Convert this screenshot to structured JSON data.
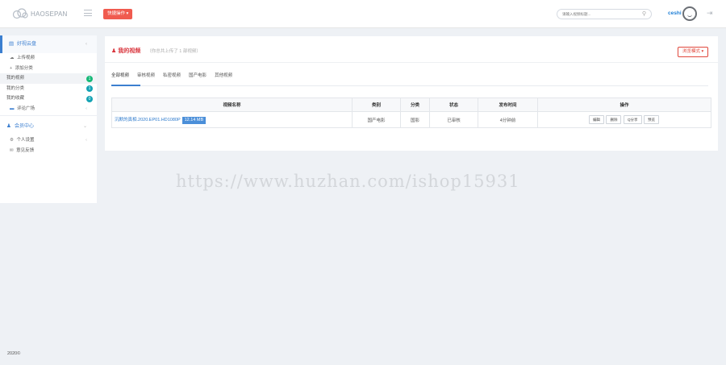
{
  "topbar": {
    "logo_text": "HAOSEPAN",
    "quick_action_label": "快捷操作 ▾",
    "search_placeholder": "请输入视频标题...",
    "username": "ceshi"
  },
  "sidebar": {
    "groups": [
      {
        "label": "好视云盘",
        "items": [
          {
            "label": "上传视频",
            "icon": "cloud-upload-icon"
          },
          {
            "label": "添加分类",
            "icon": "plus-icon"
          },
          {
            "label": "我的视频",
            "badge": "1",
            "badge_color": "#17b978"
          },
          {
            "label": "我的分类",
            "badge": "1",
            "badge_color": "#15a3b4"
          },
          {
            "label": "我的收藏",
            "badge": "0",
            "badge_color": "#15a3b4"
          },
          {
            "label": "评论广场",
            "icon": "folder-icon"
          }
        ]
      },
      {
        "label": "会员中心",
        "items": [
          {
            "label": "个人设置",
            "icon": "gear-icon"
          },
          {
            "label": "意见反馈",
            "icon": "chat-icon"
          }
        ]
      }
    ]
  },
  "main": {
    "title": "我的视频",
    "subtitle": "（你总共上传了 1 部视频）",
    "view_mode_label": "浏览模式 ▾",
    "tabs": [
      "全部视频",
      "审核视频",
      "私密视频",
      "国产电影",
      "其他视频"
    ],
    "table": {
      "headers": [
        "视频名称",
        "类别",
        "分类",
        "状态",
        "发布时间",
        "操作"
      ],
      "rows": [
        {
          "name": "沉默的真相.2020.EP01.HD1080P",
          "size": "12.14 MB",
          "category": "国产电影",
          "class": "国影",
          "status": "已审核",
          "time": "4分钟前",
          "actions": [
            "编辑",
            "删除",
            "Q分享",
            "预览"
          ]
        }
      ]
    }
  },
  "watermark": "https://www.huzhan.com/ishop15931",
  "footer": "2020©",
  "colors": {
    "accent_blue": "#3c7fd0",
    "accent_red": "#f05b4f",
    "status_green": "#1ba34b"
  }
}
